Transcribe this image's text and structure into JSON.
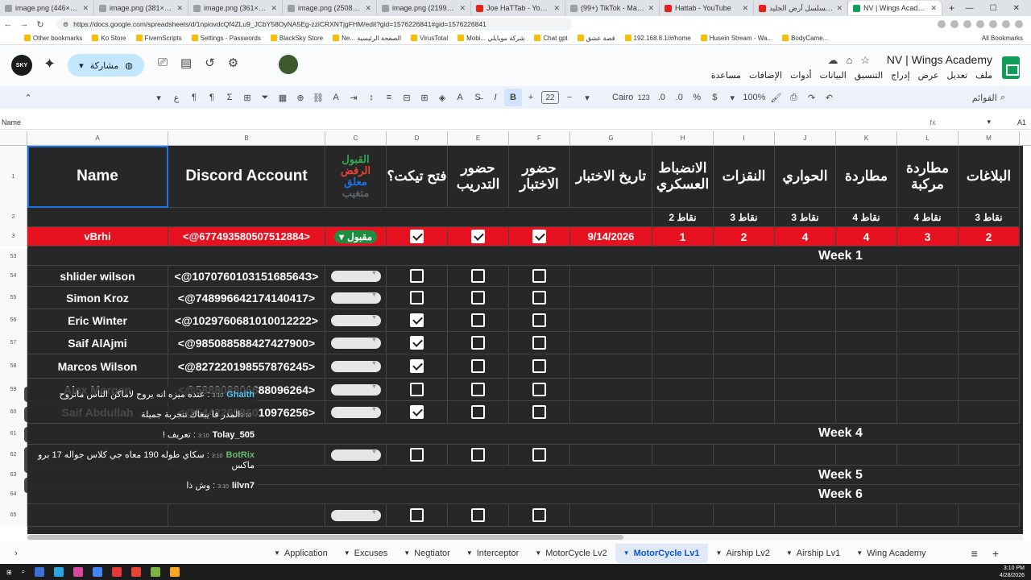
{
  "browser": {
    "tabs": [
      {
        "title": "image.png (446×680)",
        "kind": "img"
      },
      {
        "title": "image.png (381×680)",
        "kind": "img"
      },
      {
        "title": "image.png (361×680)",
        "kind": "img"
      },
      {
        "title": "image.png (2508×1220)",
        "kind": "img"
      },
      {
        "title": "image.png (2199×1157)",
        "kind": "img"
      },
      {
        "title": "Joe HaTTab - YouTube",
        "kind": "yt"
      },
      {
        "title": "(99+) TikTok - Make Your Day",
        "kind": "img"
      },
      {
        "title": "Hattab - YouTube",
        "kind": "yt"
      },
      {
        "title": "أخيرا وصلنا لمسلسل أرض الجليد",
        "kind": "yt"
      },
      {
        "title": "NV | Wings Academy - بيانات",
        "kind": "sh"
      }
    ],
    "url": "https://docs.google.com/spreadsheets/d/1npiovdcQf4ZLu9_JCbY58OyNA5Eg-zziCRXNTjgFHM/edit?gid=1576226841#gid=1576226841",
    "bookmarks": [
      "Other bookmarks",
      "Ko Store",
      "FivemScripts",
      "Settings - Passwords",
      "BlackSky Store",
      "Ne... الصفحة الرئيسية",
      "VirusTotal",
      "Mobi... شركة موبايلي",
      "Chat gpt",
      "قصة عشق",
      "192.168.8.1/#/home",
      "Husein Stream - Wa...",
      "BodyCame..."
    ],
    "all_bookmarks": "All Bookmarks"
  },
  "sheet": {
    "title": "NV | Wings Academy",
    "menus": [
      "ملف",
      "تعديل",
      "عرض",
      "إدراج",
      "التنسيق",
      "البيانات",
      "أدوات",
      "الإضافات",
      "مساعدة"
    ],
    "share_label": "مشاركة",
    "avatar_text": "SKY",
    "toolbar": {
      "menus_label": "القوائم",
      "zoom": "100%",
      "font": "Cairo",
      "font_size": "22",
      "format_num": "123"
    },
    "name_box": "Name",
    "cell_ref": "A1"
  },
  "columns": [
    "A",
    "B",
    "C",
    "D",
    "E",
    "F",
    "G",
    "H",
    "I",
    "J",
    "K",
    "L",
    "M"
  ],
  "headers": {
    "name": "Name",
    "discord": "Discord Account",
    "status_options": [
      "القبول",
      "الرفض",
      "معلق",
      "متغيب"
    ],
    "ticket": "فتح تيكت؟",
    "training": "حضور التدريب",
    "test": "حضور الاختبار",
    "test_date": "تاريخ الاختبار",
    "discipline": "الانضباط العسكري",
    "moves": "النقزات",
    "dialogue": "الحواري",
    "chase": "مطاردة",
    "combo_chase": "مطاردة مركبة",
    "reports": "البلاغات"
  },
  "points": [
    "2 نقاط",
    "3 نقاط",
    "3 نقاط",
    "4 نقاط",
    "4 نقاط",
    "3 نقاط"
  ],
  "row_numbers": [
    "1",
    "2",
    "3",
    "52",
    "53",
    "54",
    "55",
    "56",
    "57",
    "58",
    "59",
    "60",
    "61",
    "62",
    "63",
    "64",
    "65"
  ],
  "first_row": {
    "name": "vBrhi",
    "discord": "<@677493580507512884>",
    "status": "مقبول",
    "date": "9/14/2026",
    "scores": [
      "1",
      "2",
      "4",
      "4",
      "3",
      "2"
    ]
  },
  "weeks": [
    "Week 1",
    "Week 4",
    "Week 5",
    "Week 6"
  ],
  "members": [
    {
      "name": "shlider wilson",
      "discord": "<@107076010315168564З>",
      "ticket": false
    },
    {
      "name": "Simon Kroz",
      "discord": "<@748996642174140417>",
      "ticket": false
    },
    {
      "name": "Eric Winter",
      "discord": "<@1029760681010012222>",
      "ticket": true
    },
    {
      "name": "Saif AlAjmi",
      "discord": "<@985088588427427900>",
      "ticket": true
    },
    {
      "name": "Marcos Wilson",
      "discord": "<@827220198557876245>",
      "ticket": true
    },
    {
      "name": "Alex Morgen",
      "discord": "<@588808806688096264>",
      "ticket": false
    },
    {
      "name": "Saif Abdullah",
      "discord": "<@544226586010976256>",
      "ticket": true
    }
  ],
  "chat": [
    {
      "time": "3:10",
      "user": "Ghaith",
      "text": "عنده ميزه انه يروح لاماكن الناس ماتروح",
      "user_color": "#4fc3f7"
    },
    {
      "time": "3:10",
      "user": "",
      "text": "المدر قا يبغاك تتجربة جميلة",
      "user_color": "#ffffff"
    },
    {
      "time": "3:10",
      "user": "Tolay_505",
      "text": "تعريف !",
      "user_color": "#ffffff"
    },
    {
      "time": "3:10",
      "user": "BotRix",
      "text": "سكاي طوله 190 معاه جي كلاس جواله 17 برو ماكس",
      "user_color": "#66bb6a"
    },
    {
      "time": "3:10",
      "user": "lilvn7",
      "text": "وش ذا",
      "user_color": "#ffffff"
    }
  ],
  "sheet_tabs": [
    {
      "label": "Application",
      "active": false
    },
    {
      "label": "Excuses",
      "active": false
    },
    {
      "label": "Negtiator",
      "active": false
    },
    {
      "label": "Interceptor",
      "active": false
    },
    {
      "label": "MotorCycle Lv2",
      "active": false
    },
    {
      "label": "MotorCycle Lv1",
      "active": true
    },
    {
      "label": "Airship Lv2",
      "active": false
    },
    {
      "label": "Airship Lv1",
      "active": false
    },
    {
      "label": "Wing Academy",
      "active": false
    }
  ],
  "clock": {
    "time": "3:10 PM",
    "date": "4/28/2026"
  },
  "colors": {
    "grid_bg": "#272727",
    "first_row": "#e8111f",
    "accept_green": "#1e8e3e",
    "accent": "#0b57d0"
  }
}
